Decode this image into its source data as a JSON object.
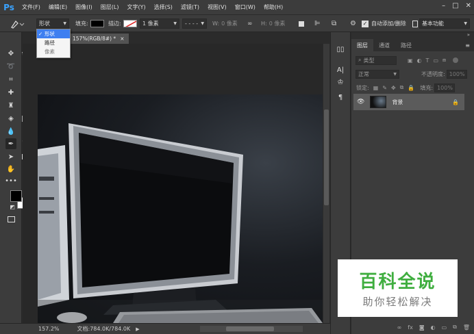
{
  "menu": {
    "logo": "Ps",
    "items": [
      "文件(F)",
      "编辑(E)",
      "图像(I)",
      "图层(L)",
      "文字(Y)",
      "选择(S)",
      "滤镜(T)",
      "视图(V)",
      "窗口(W)",
      "帮助(H)"
    ]
  },
  "options": {
    "mode_value": "形状",
    "fill_label": "填充:",
    "stroke_label": "描边:",
    "stroke_width": "1 像素",
    "w_label": "W:",
    "w_value": "0 像素",
    "h_label": "H:",
    "h_value": "0 像素",
    "auto_add_label": "自动添加/删除",
    "auto_add_checked": true,
    "workspace": "基本功能"
  },
  "mode_dropdown": {
    "items": [
      {
        "label": "形状",
        "selected": true
      },
      {
        "label": "路径",
        "selected": false
      },
      {
        "label": "像素",
        "selected": false
      }
    ]
  },
  "document": {
    "tab_title": "157%(RGB/8#) *",
    "close": "×"
  },
  "status": {
    "zoom": "157.2%",
    "doc_info": "文档:784.0K/784.0K"
  },
  "panels": {
    "tabs": [
      "图层",
      "通道",
      "路径"
    ],
    "filter_placeholder": "类型",
    "blend_mode": "正常",
    "opacity_label": "不透明度:",
    "opacity_value": "100%",
    "lock_label": "锁定:",
    "fill_label": "填充:",
    "fill_value": "100%",
    "layer_name": "背景"
  },
  "watermark": {
    "title": "百科全说",
    "subtitle": "助你轻松解决"
  },
  "colors": {
    "accent": "#3aa3ff",
    "watermark_green": "#3fae3f"
  }
}
